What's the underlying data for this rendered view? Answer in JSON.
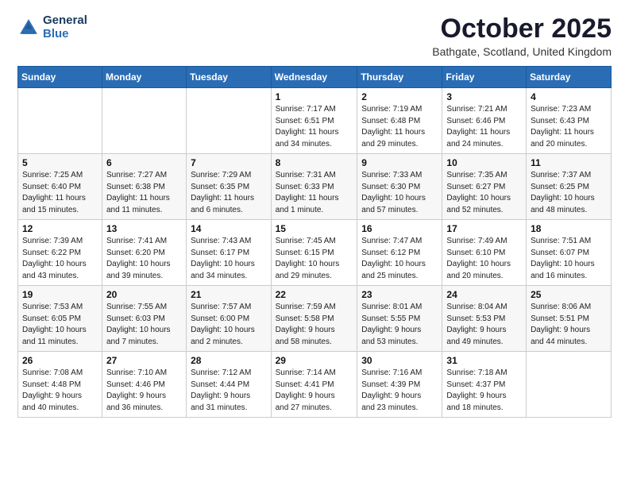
{
  "header": {
    "logo_general": "General",
    "logo_blue": "Blue",
    "month_title": "October 2025",
    "location": "Bathgate, Scotland, United Kingdom"
  },
  "days_of_week": [
    "Sunday",
    "Monday",
    "Tuesday",
    "Wednesday",
    "Thursday",
    "Friday",
    "Saturday"
  ],
  "weeks": [
    [
      {
        "day": "",
        "info": ""
      },
      {
        "day": "",
        "info": ""
      },
      {
        "day": "",
        "info": ""
      },
      {
        "day": "1",
        "info": "Sunrise: 7:17 AM\nSunset: 6:51 PM\nDaylight: 11 hours\nand 34 minutes."
      },
      {
        "day": "2",
        "info": "Sunrise: 7:19 AM\nSunset: 6:48 PM\nDaylight: 11 hours\nand 29 minutes."
      },
      {
        "day": "3",
        "info": "Sunrise: 7:21 AM\nSunset: 6:46 PM\nDaylight: 11 hours\nand 24 minutes."
      },
      {
        "day": "4",
        "info": "Sunrise: 7:23 AM\nSunset: 6:43 PM\nDaylight: 11 hours\nand 20 minutes."
      }
    ],
    [
      {
        "day": "5",
        "info": "Sunrise: 7:25 AM\nSunset: 6:40 PM\nDaylight: 11 hours\nand 15 minutes."
      },
      {
        "day": "6",
        "info": "Sunrise: 7:27 AM\nSunset: 6:38 PM\nDaylight: 11 hours\nand 11 minutes."
      },
      {
        "day": "7",
        "info": "Sunrise: 7:29 AM\nSunset: 6:35 PM\nDaylight: 11 hours\nand 6 minutes."
      },
      {
        "day": "8",
        "info": "Sunrise: 7:31 AM\nSunset: 6:33 PM\nDaylight: 11 hours\nand 1 minute."
      },
      {
        "day": "9",
        "info": "Sunrise: 7:33 AM\nSunset: 6:30 PM\nDaylight: 10 hours\nand 57 minutes."
      },
      {
        "day": "10",
        "info": "Sunrise: 7:35 AM\nSunset: 6:27 PM\nDaylight: 10 hours\nand 52 minutes."
      },
      {
        "day": "11",
        "info": "Sunrise: 7:37 AM\nSunset: 6:25 PM\nDaylight: 10 hours\nand 48 minutes."
      }
    ],
    [
      {
        "day": "12",
        "info": "Sunrise: 7:39 AM\nSunset: 6:22 PM\nDaylight: 10 hours\nand 43 minutes."
      },
      {
        "day": "13",
        "info": "Sunrise: 7:41 AM\nSunset: 6:20 PM\nDaylight: 10 hours\nand 39 minutes."
      },
      {
        "day": "14",
        "info": "Sunrise: 7:43 AM\nSunset: 6:17 PM\nDaylight: 10 hours\nand 34 minutes."
      },
      {
        "day": "15",
        "info": "Sunrise: 7:45 AM\nSunset: 6:15 PM\nDaylight: 10 hours\nand 29 minutes."
      },
      {
        "day": "16",
        "info": "Sunrise: 7:47 AM\nSunset: 6:12 PM\nDaylight: 10 hours\nand 25 minutes."
      },
      {
        "day": "17",
        "info": "Sunrise: 7:49 AM\nSunset: 6:10 PM\nDaylight: 10 hours\nand 20 minutes."
      },
      {
        "day": "18",
        "info": "Sunrise: 7:51 AM\nSunset: 6:07 PM\nDaylight: 10 hours\nand 16 minutes."
      }
    ],
    [
      {
        "day": "19",
        "info": "Sunrise: 7:53 AM\nSunset: 6:05 PM\nDaylight: 10 hours\nand 11 minutes."
      },
      {
        "day": "20",
        "info": "Sunrise: 7:55 AM\nSunset: 6:03 PM\nDaylight: 10 hours\nand 7 minutes."
      },
      {
        "day": "21",
        "info": "Sunrise: 7:57 AM\nSunset: 6:00 PM\nDaylight: 10 hours\nand 2 minutes."
      },
      {
        "day": "22",
        "info": "Sunrise: 7:59 AM\nSunset: 5:58 PM\nDaylight: 9 hours\nand 58 minutes."
      },
      {
        "day": "23",
        "info": "Sunrise: 8:01 AM\nSunset: 5:55 PM\nDaylight: 9 hours\nand 53 minutes."
      },
      {
        "day": "24",
        "info": "Sunrise: 8:04 AM\nSunset: 5:53 PM\nDaylight: 9 hours\nand 49 minutes."
      },
      {
        "day": "25",
        "info": "Sunrise: 8:06 AM\nSunset: 5:51 PM\nDaylight: 9 hours\nand 44 minutes."
      }
    ],
    [
      {
        "day": "26",
        "info": "Sunrise: 7:08 AM\nSunset: 4:48 PM\nDaylight: 9 hours\nand 40 minutes."
      },
      {
        "day": "27",
        "info": "Sunrise: 7:10 AM\nSunset: 4:46 PM\nDaylight: 9 hours\nand 36 minutes."
      },
      {
        "day": "28",
        "info": "Sunrise: 7:12 AM\nSunset: 4:44 PM\nDaylight: 9 hours\nand 31 minutes."
      },
      {
        "day": "29",
        "info": "Sunrise: 7:14 AM\nSunset: 4:41 PM\nDaylight: 9 hours\nand 27 minutes."
      },
      {
        "day": "30",
        "info": "Sunrise: 7:16 AM\nSunset: 4:39 PM\nDaylight: 9 hours\nand 23 minutes."
      },
      {
        "day": "31",
        "info": "Sunrise: 7:18 AM\nSunset: 4:37 PM\nDaylight: 9 hours\nand 18 minutes."
      },
      {
        "day": "",
        "info": ""
      }
    ]
  ]
}
